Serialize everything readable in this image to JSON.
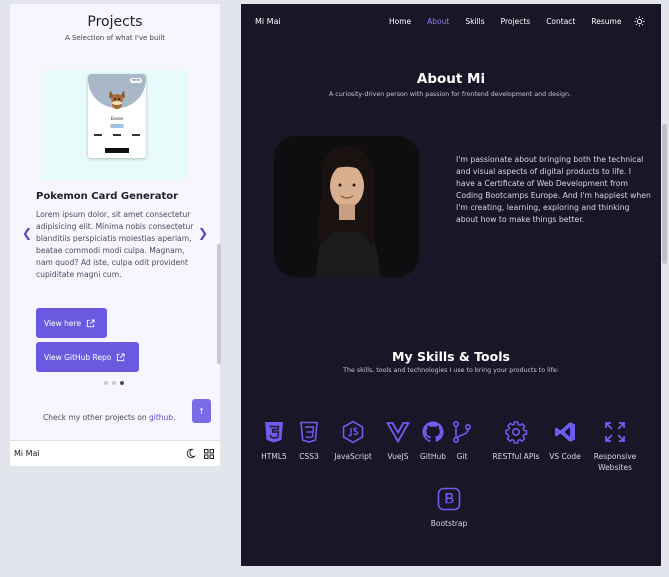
{
  "mobile": {
    "section_title": "Projects",
    "section_subtitle": "A Selection of what I've built",
    "card_preview": {
      "hp": "HP 55",
      "name": "Eevee"
    },
    "project_title": "Pokemon Card Generator",
    "project_description": "Lorem ipsum dolor, sit amet consectetur adipisicing elit. Minima nobis consectetur blanditiis perspiciatis molestias aperiam, beatae commodi modi culpa. Magnam, nam quod? Ad iste, culpa odit provident cupiditate magni cum.",
    "view_here_label": "View here",
    "github_repo_label": "View GitHub Repo",
    "check_text": "Check my other projects on ",
    "github_link": "github",
    "check_suffix": ".",
    "bottom_brand": "Mi Mai",
    "carousel_dots": 3,
    "carousel_active": 3,
    "colors": {
      "accent": "#6b5ae0",
      "background": "#f7f6fe"
    }
  },
  "desktop": {
    "brand": "Mi Mai",
    "nav": [
      "Home",
      "About",
      "Skills",
      "Projects",
      "Contact",
      "Resume"
    ],
    "nav_active": "About",
    "about_title": "About Mi",
    "about_subtitle": "A curiosity-driven person with passion for frontend development and design.",
    "bio": "I'm passionate about bringing both the technical and visual aspects of digital products to life. I have a Certificate of Web Development from Coding Bootcamps Europe. And I'm happiest when I'm creating, learning, exploring and thinking about how to make things better.",
    "skills_title": "My Skills & Tools",
    "skills_subtitle": "The skills, tools and technologies I use to bring your products to life:",
    "skills": [
      "HTML5",
      "CSS3",
      "JavaScript",
      "VueJS",
      "GitHub",
      "Git",
      "RESTful APIs",
      "VS Code",
      "Responsive Websites",
      "Bootstrap"
    ],
    "colors": {
      "background": "#1a1527",
      "accent": "#8b80f0",
      "icon": "#6e5bf0"
    }
  }
}
